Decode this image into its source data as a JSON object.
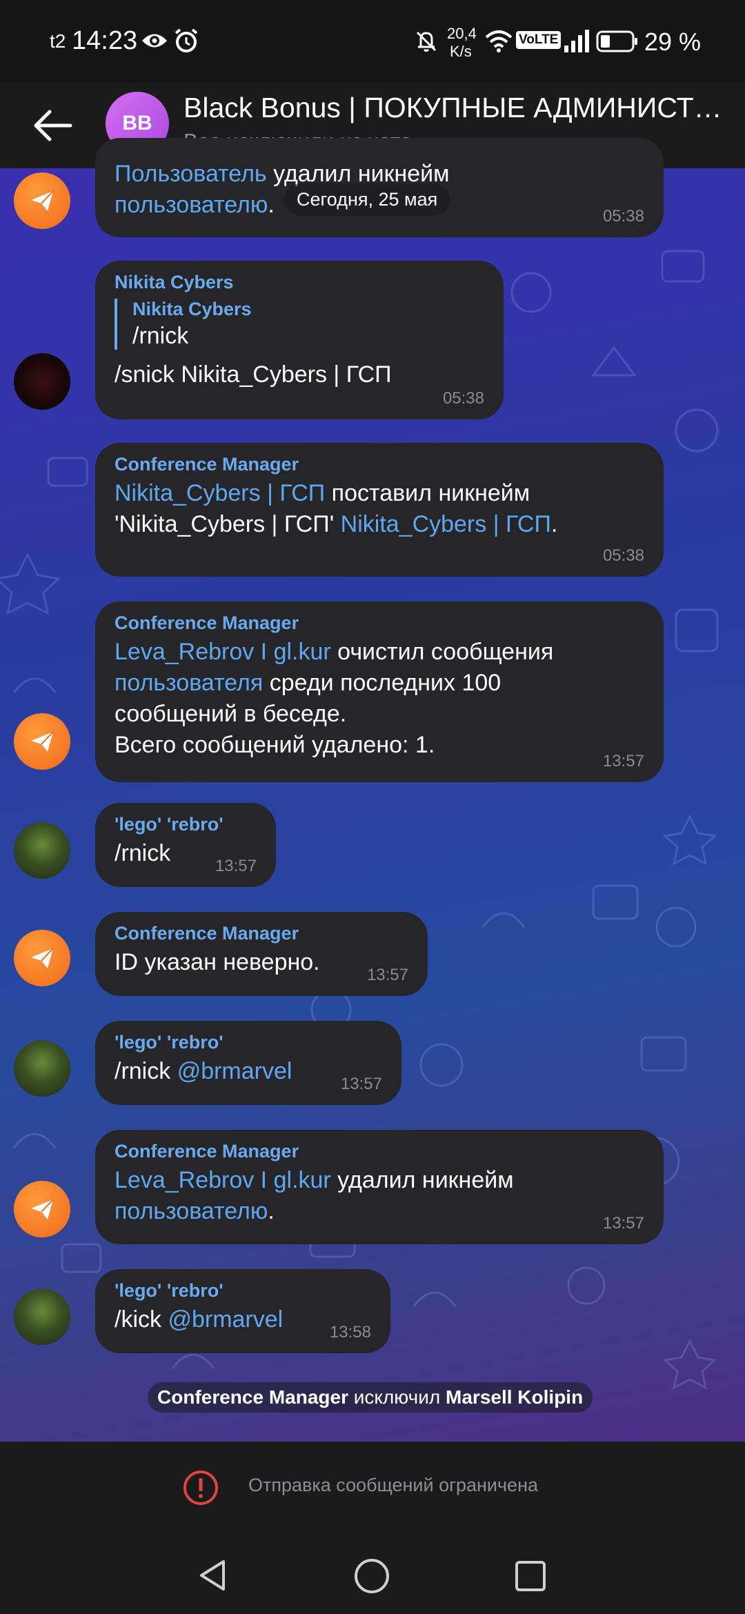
{
  "status_bar": {
    "carrier": "t2",
    "time": "14:23",
    "net_speed_value": "20,4",
    "net_speed_unit": "K/s",
    "volte": "VoLTE",
    "battery": "29 %"
  },
  "header": {
    "avatar_initials": "BB",
    "title": "Black Bonus | ПОКУПНЫЕ АДМИНИСТРАТОРЫ",
    "subtitle": "Вас исключили из чата"
  },
  "chat": {
    "date_pill": "Сегодня, 25 мая",
    "messages": [
      {
        "part1": "Пользователь",
        "part2": " удалил никнейм",
        "part3": "пользователю",
        "part4": ".",
        "time": "05:38"
      },
      {
        "sender": "Nikita Cybers",
        "reply_name": "Nikita Cybers",
        "reply_text": "/rnick",
        "text": "/snick Nikita_Cybers | ГСП",
        "time": "05:38"
      },
      {
        "sender": "Conference Manager",
        "part1": "Nikita_Cybers | ГСП",
        "part2": " поставил никнейм",
        "part3": "'Nikita_Cybers | ГСП' ",
        "part4": "Nikita_Cybers | ГСП",
        "part5": ".",
        "time": "05:38"
      },
      {
        "sender": "Conference Manager",
        "part1": "Leva_Rebrov I gl.kur",
        "part2": " очистил сообщения",
        "part3": "пользователя",
        "part4": " среди последних 100",
        "line3": "сообщений в беседе.",
        "line4": "Всего сообщений удалено: 1.",
        "time": "13:57"
      },
      {
        "sender": "'lego' 'rebro'",
        "text": "/rnick",
        "time": "13:57"
      },
      {
        "sender": "Conference Manager",
        "text": "ID указан неверно.",
        "time": "13:57"
      },
      {
        "sender": "'lego' 'rebro'",
        "part1": "/rnick ",
        "part2": "@brmarvel",
        "time": "13:57"
      },
      {
        "sender": "Conference Manager",
        "part1": "Leva_Rebrov I gl.kur",
        "part2": " удалил никнейм",
        "part3": "пользователю",
        "part4": ".",
        "time": "13:57"
      },
      {
        "sender": "'lego' 'rebro'",
        "part1": "/kick ",
        "part2": "@brmarvel",
        "time": "13:58"
      }
    ],
    "service": {
      "actor": "Conference Manager",
      "action": " исключил ",
      "target": "Marsell Kolipin"
    }
  },
  "footer": {
    "restriction_text": "Отправка сообщений ограничена"
  },
  "colors": {
    "accent_link": "#5ea8f2",
    "sender_name": "#6aaaf0",
    "bubble_bg": "#262628",
    "warning_red": "#e0443e"
  },
  "icons": [
    "eye-icon",
    "alarm-icon",
    "mute-icon",
    "wifi-icon",
    "signal-icon",
    "battery-icon",
    "back-arrow-icon",
    "send-plane-icon",
    "warning-icon",
    "nav-back-icon",
    "nav-home-icon",
    "nav-recents-icon"
  ]
}
